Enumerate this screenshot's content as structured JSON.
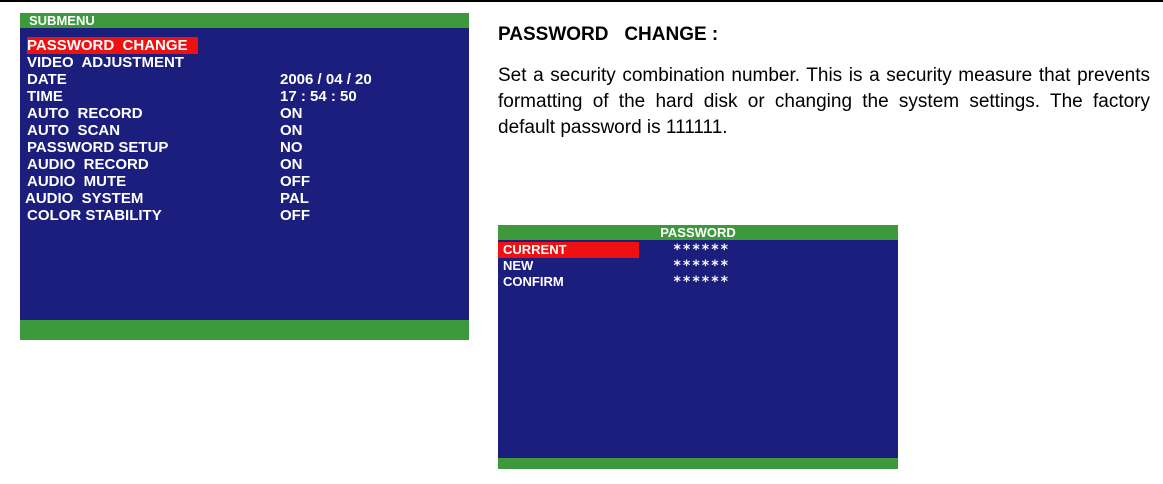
{
  "submenu": {
    "title": "SUBMENU",
    "items": [
      {
        "label": "PASSWORD  CHANGE",
        "value": ""
      },
      {
        "label": "VIDEO  ADJUSTMENT",
        "value": ""
      },
      {
        "label": "DATE",
        "value": "2006 / 04 / 20"
      },
      {
        "label": "TIME",
        "value": "17 : 54 : 50"
      },
      {
        "label": "AUTO  RECORD",
        "value": "ON"
      },
      {
        "label": "AUTO  SCAN",
        "value": "ON"
      },
      {
        "label": "PASSWORD SETUP",
        "value": "NO"
      },
      {
        "label": "AUDIO  RECORD",
        "value": "ON"
      },
      {
        "label": "AUDIO  MUTE",
        "value": "OFF"
      },
      {
        "label": "AUDIO  SYSTEM",
        "value": "PAL"
      },
      {
        "label": "COLOR STABILITY",
        "value": "OFF"
      }
    ],
    "selected_index": 0
  },
  "section": {
    "title": "PASSWORD   CHANGE :",
    "body": "Set a security combination number. This is a security measure that prevents formatting of the hard disk or changing the system settings. The factory default password is 111111."
  },
  "password": {
    "title": "PASSWORD",
    "rows": [
      {
        "label": "CURRENT",
        "value": "******"
      },
      {
        "label": "NEW",
        "value": "******"
      },
      {
        "label": "CONFIRM",
        "value": "******"
      }
    ],
    "selected_index": 0
  },
  "colors": {
    "screen_bg": "#1b1e7c",
    "header_green": "#3c9a3c",
    "highlight_red": "#ee1111",
    "text_white": "#ffffff"
  }
}
